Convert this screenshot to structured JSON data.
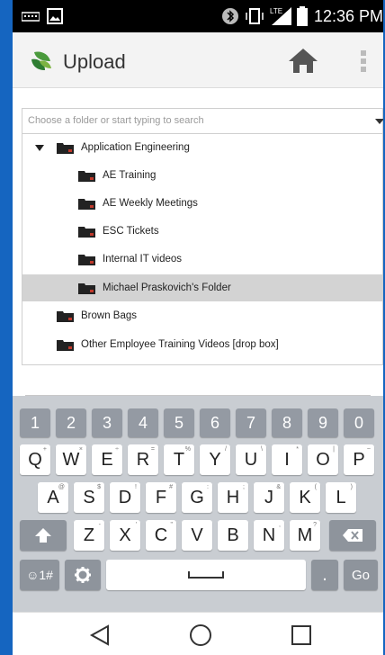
{
  "status_bar": {
    "time": "12:36 PM",
    "network": "LTE"
  },
  "app_bar": {
    "title": "Upload",
    "icons": [
      "app-logo-icon",
      "home-icon",
      "overflow-menu-icon"
    ]
  },
  "folder_picker": {
    "placeholder": "Choose a folder or start typing to search",
    "folders": [
      {
        "label": "Application Engineering",
        "level": 0,
        "expanded": true,
        "selected": false
      },
      {
        "label": "AE Training",
        "level": 1,
        "selected": false
      },
      {
        "label": "AE Weekly Meetings",
        "level": 1,
        "selected": false
      },
      {
        "label": "ESC Tickets",
        "level": 1,
        "selected": false
      },
      {
        "label": "Internal IT videos",
        "level": 1,
        "selected": false
      },
      {
        "label": "Michael Praskovich's Folder",
        "level": 1,
        "selected": true
      },
      {
        "label": "Brown Bags",
        "level": 0,
        "selected": false
      },
      {
        "label": "Other Employee Training Videos [drop box]",
        "level": 0,
        "selected": false
      }
    ]
  },
  "keyboard": {
    "number_row": [
      {
        "key": "1",
        "sup": ""
      },
      {
        "key": "2",
        "sup": ""
      },
      {
        "key": "3",
        "sup": ""
      },
      {
        "key": "4",
        "sup": ""
      },
      {
        "key": "5",
        "sup": ""
      },
      {
        "key": "6",
        "sup": ""
      },
      {
        "key": "7",
        "sup": ""
      },
      {
        "key": "8",
        "sup": ""
      },
      {
        "key": "9",
        "sup": ""
      },
      {
        "key": "0",
        "sup": ""
      }
    ],
    "row1": [
      {
        "key": "Q",
        "sup": "+"
      },
      {
        "key": "W",
        "sup": "×"
      },
      {
        "key": "E",
        "sup": "÷"
      },
      {
        "key": "R",
        "sup": "="
      },
      {
        "key": "T",
        "sup": "%"
      },
      {
        "key": "Y",
        "sup": "/"
      },
      {
        "key": "U",
        "sup": "\\"
      },
      {
        "key": "I",
        "sup": "*"
      },
      {
        "key": "O",
        "sup": "|"
      },
      {
        "key": "P",
        "sup": "~"
      }
    ],
    "row2": [
      {
        "key": "A",
        "sup": "@"
      },
      {
        "key": "S",
        "sup": "$"
      },
      {
        "key": "D",
        "sup": "!"
      },
      {
        "key": "F",
        "sup": "#"
      },
      {
        "key": "G",
        "sup": ":"
      },
      {
        "key": "H",
        "sup": ";"
      },
      {
        "key": "J",
        "sup": "&"
      },
      {
        "key": "K",
        "sup": "("
      },
      {
        "key": "L",
        "sup": ")"
      }
    ],
    "row3": [
      {
        "key": "Z",
        "sup": "-"
      },
      {
        "key": "X",
        "sup": "'"
      },
      {
        "key": "C",
        "sup": "\""
      },
      {
        "key": "V",
        "sup": ""
      },
      {
        "key": "B",
        "sup": ""
      },
      {
        "key": "N",
        "sup": ","
      },
      {
        "key": "M",
        "sup": "?"
      }
    ],
    "symbols_key": "☺1#",
    "period_key": ".",
    "go_key": "Go"
  },
  "nav_bar": {
    "icons": [
      "back-icon",
      "home-circle-icon",
      "recents-icon"
    ]
  },
  "colors": {
    "accent_bezel": "#1565c0",
    "selected_row": "#d3d3d3",
    "keyboard_bg": "#c9cdd2",
    "number_key": "#949aa3",
    "folder": "#222222",
    "folder_accent": "#c0392b"
  }
}
